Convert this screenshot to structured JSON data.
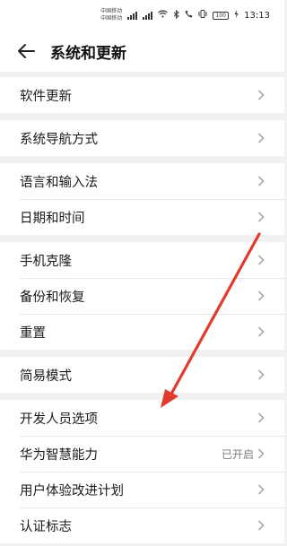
{
  "status_bar": {
    "carrier_top": "中国移动",
    "carrier_bottom": "中国移动",
    "battery": "100",
    "time": "13:13"
  },
  "header": {
    "title": "系统和更新"
  },
  "groups": [
    {
      "items": [
        {
          "label": "软件更新"
        }
      ]
    },
    {
      "items": [
        {
          "label": "系统导航方式"
        }
      ]
    },
    {
      "items": [
        {
          "label": "语言和输入法"
        },
        {
          "label": "日期和时间"
        }
      ]
    },
    {
      "items": [
        {
          "label": "手机克隆"
        },
        {
          "label": "备份和恢复"
        },
        {
          "label": "重置"
        }
      ]
    },
    {
      "items": [
        {
          "label": "简易模式"
        }
      ]
    },
    {
      "items": [
        {
          "label": "开发人员选项"
        },
        {
          "label": "华为智慧能力",
          "status": "已开启"
        },
        {
          "label": "用户体验改进计划"
        },
        {
          "label": "认证标志"
        }
      ]
    }
  ],
  "annotation": {
    "arrow_color": "#e23a2e"
  },
  "icons": {
    "back": "back-arrow-icon",
    "chevron": "chevron-right-icon"
  }
}
